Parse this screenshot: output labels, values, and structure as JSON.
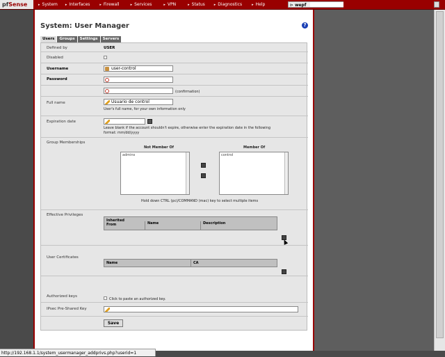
{
  "nav": {
    "logo_main": "Sense",
    "logo_prefix": "pf",
    "items": [
      "System",
      "Interfaces",
      "Firewall",
      "Services",
      "VPN",
      "Status",
      "Diagnostics",
      "Help"
    ],
    "user_label": "wepf"
  },
  "page": {
    "title": "System: User Manager",
    "tabs": [
      "Users",
      "Groups",
      "Settings",
      "Servers"
    ],
    "active_tab": "Users"
  },
  "form": {
    "defined_by": {
      "label": "Defined by",
      "value": "USER"
    },
    "disabled": {
      "label": "Disabled"
    },
    "username": {
      "label": "Username",
      "value": "user-control"
    },
    "password": {
      "label": "Password",
      "confirmation": "(confirmation)"
    },
    "full_name": {
      "label": "Full name",
      "value": "Usuario de control",
      "hint": "User's full name, for your own information only"
    },
    "expiration": {
      "label": "Expiration date",
      "hint1": "Leave blank if the account shouldn't expire, otherwise enter the expiration date in the following",
      "hint2": "format: mm/dd/yyyy"
    },
    "groups": {
      "label": "Group Memberships",
      "not_member_header": "Not Member Of",
      "member_header": "Member Of",
      "not_member_items": [
        "admins"
      ],
      "member_items": [
        "control"
      ],
      "hint": "Hold down CTRL (pc)/COMMAND (mac) key to select multiple items"
    },
    "privileges": {
      "label": "Effective Privileges",
      "columns": [
        "Inherited From",
        "Name",
        "Description"
      ],
      "col0_line1": "Inherited",
      "col0_line2": "From"
    },
    "certificates": {
      "label": "User Certificates",
      "columns": [
        "Name",
        "CA"
      ]
    },
    "authorized_keys": {
      "label": "Authorized keys",
      "hint": "Click to paste an authorized key."
    },
    "ipsec": {
      "label": "IPsec Pre-Shared Key"
    },
    "save_label": "Save"
  },
  "status_bar": "http://192.168.1.1/system_usermanager_addprivs.php?userid=1"
}
